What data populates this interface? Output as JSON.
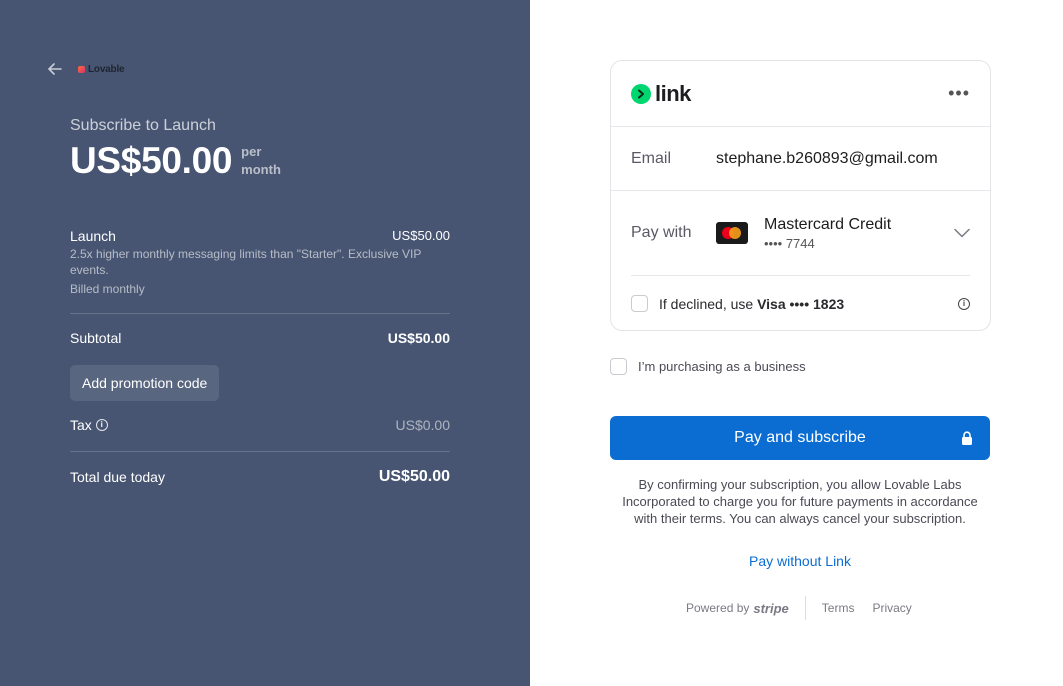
{
  "order": {
    "brand": "Lovable",
    "subscribe_title": "Subscribe to Launch",
    "price": "US$50.00",
    "per": "per",
    "period": "month",
    "item": {
      "name": "Launch",
      "price": "US$50.00",
      "description": "2.5x higher monthly messaging limits than \"Starter\". Exclusive VIP events.",
      "billing": "Billed monthly"
    },
    "subtotal_label": "Subtotal",
    "subtotal_value": "US$50.00",
    "promo_label": "Add promotion code",
    "tax_label": "Tax",
    "tax_value": "US$0.00",
    "total_label": "Total due today",
    "total_value": "US$50.00"
  },
  "link": {
    "logo_text": "link",
    "menu_icon": "more-dots-icon",
    "email_label": "Email",
    "email_value": "stephane.b260893@gmail.com",
    "pay_with_label": "Pay with",
    "card_name": "Mastercard Credit",
    "card_number": "•••• 7744",
    "declined_prefix": "If declined, use",
    "declined_card": "Visa •••• 1823"
  },
  "business_label": "I’m purchasing as a business",
  "pay_button_label": "Pay and subscribe",
  "consent_text": "By confirming your subscription, you allow Lovable Labs Incorporated to charge you for future payments in accordance with their terms. You can always cancel your subscription.",
  "pay_without_link": "Pay without Link",
  "footer": {
    "powered_by": "Powered by",
    "stripe": "stripe",
    "terms": "Terms",
    "privacy": "Privacy"
  },
  "colors": {
    "left_panel": "#475572",
    "primary": "#0b6dd1",
    "link_green": "#00d66f"
  }
}
